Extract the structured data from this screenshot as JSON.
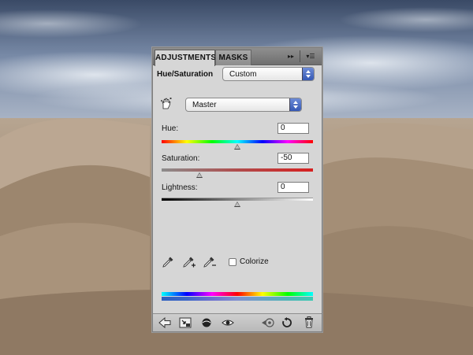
{
  "panel": {
    "tabs": [
      {
        "label": "ADJUSTMENTS",
        "active": true
      },
      {
        "label": "MASKS",
        "active": false
      }
    ],
    "tab_buttons": {
      "collapse": "▸▸",
      "menu": "▾☰"
    },
    "preset": {
      "label": "Hue/Saturation",
      "value": "Custom"
    },
    "channel": {
      "value": "Master"
    },
    "hue": {
      "label": "Hue:",
      "value": "0",
      "level": 0,
      "range": [
        -180,
        180
      ]
    },
    "saturation": {
      "label": "Saturation:",
      "value": "-50",
      "level": -50,
      "range": [
        -100,
        100
      ]
    },
    "lightness": {
      "label": "Lightness:",
      "value": "0",
      "level": 0,
      "range": [
        -100,
        100
      ]
    },
    "colorize": {
      "label": "Colorize",
      "checked": false
    }
  },
  "colors": {
    "panel_bg": "#d6d6d6",
    "tab_bar": "#7f7f7f",
    "select_arrow": "#3f62c2",
    "saturation_bar_start": "#8c8c8c",
    "saturation_bar_end": "#d62020"
  },
  "icons": {
    "target_adjust": "hand-target-icon",
    "eyedropper": "eyedropper-icon",
    "eyedropper_add": "eyedropper-plus-icon",
    "eyedropper_subtract": "eyedropper-minus-icon",
    "bottom": [
      "return-arrow-icon",
      "clip-to-layer-icon",
      "visibility-toggle-icon",
      "eye-icon",
      "previous-state-icon",
      "reset-icon",
      "trash-icon"
    ]
  }
}
